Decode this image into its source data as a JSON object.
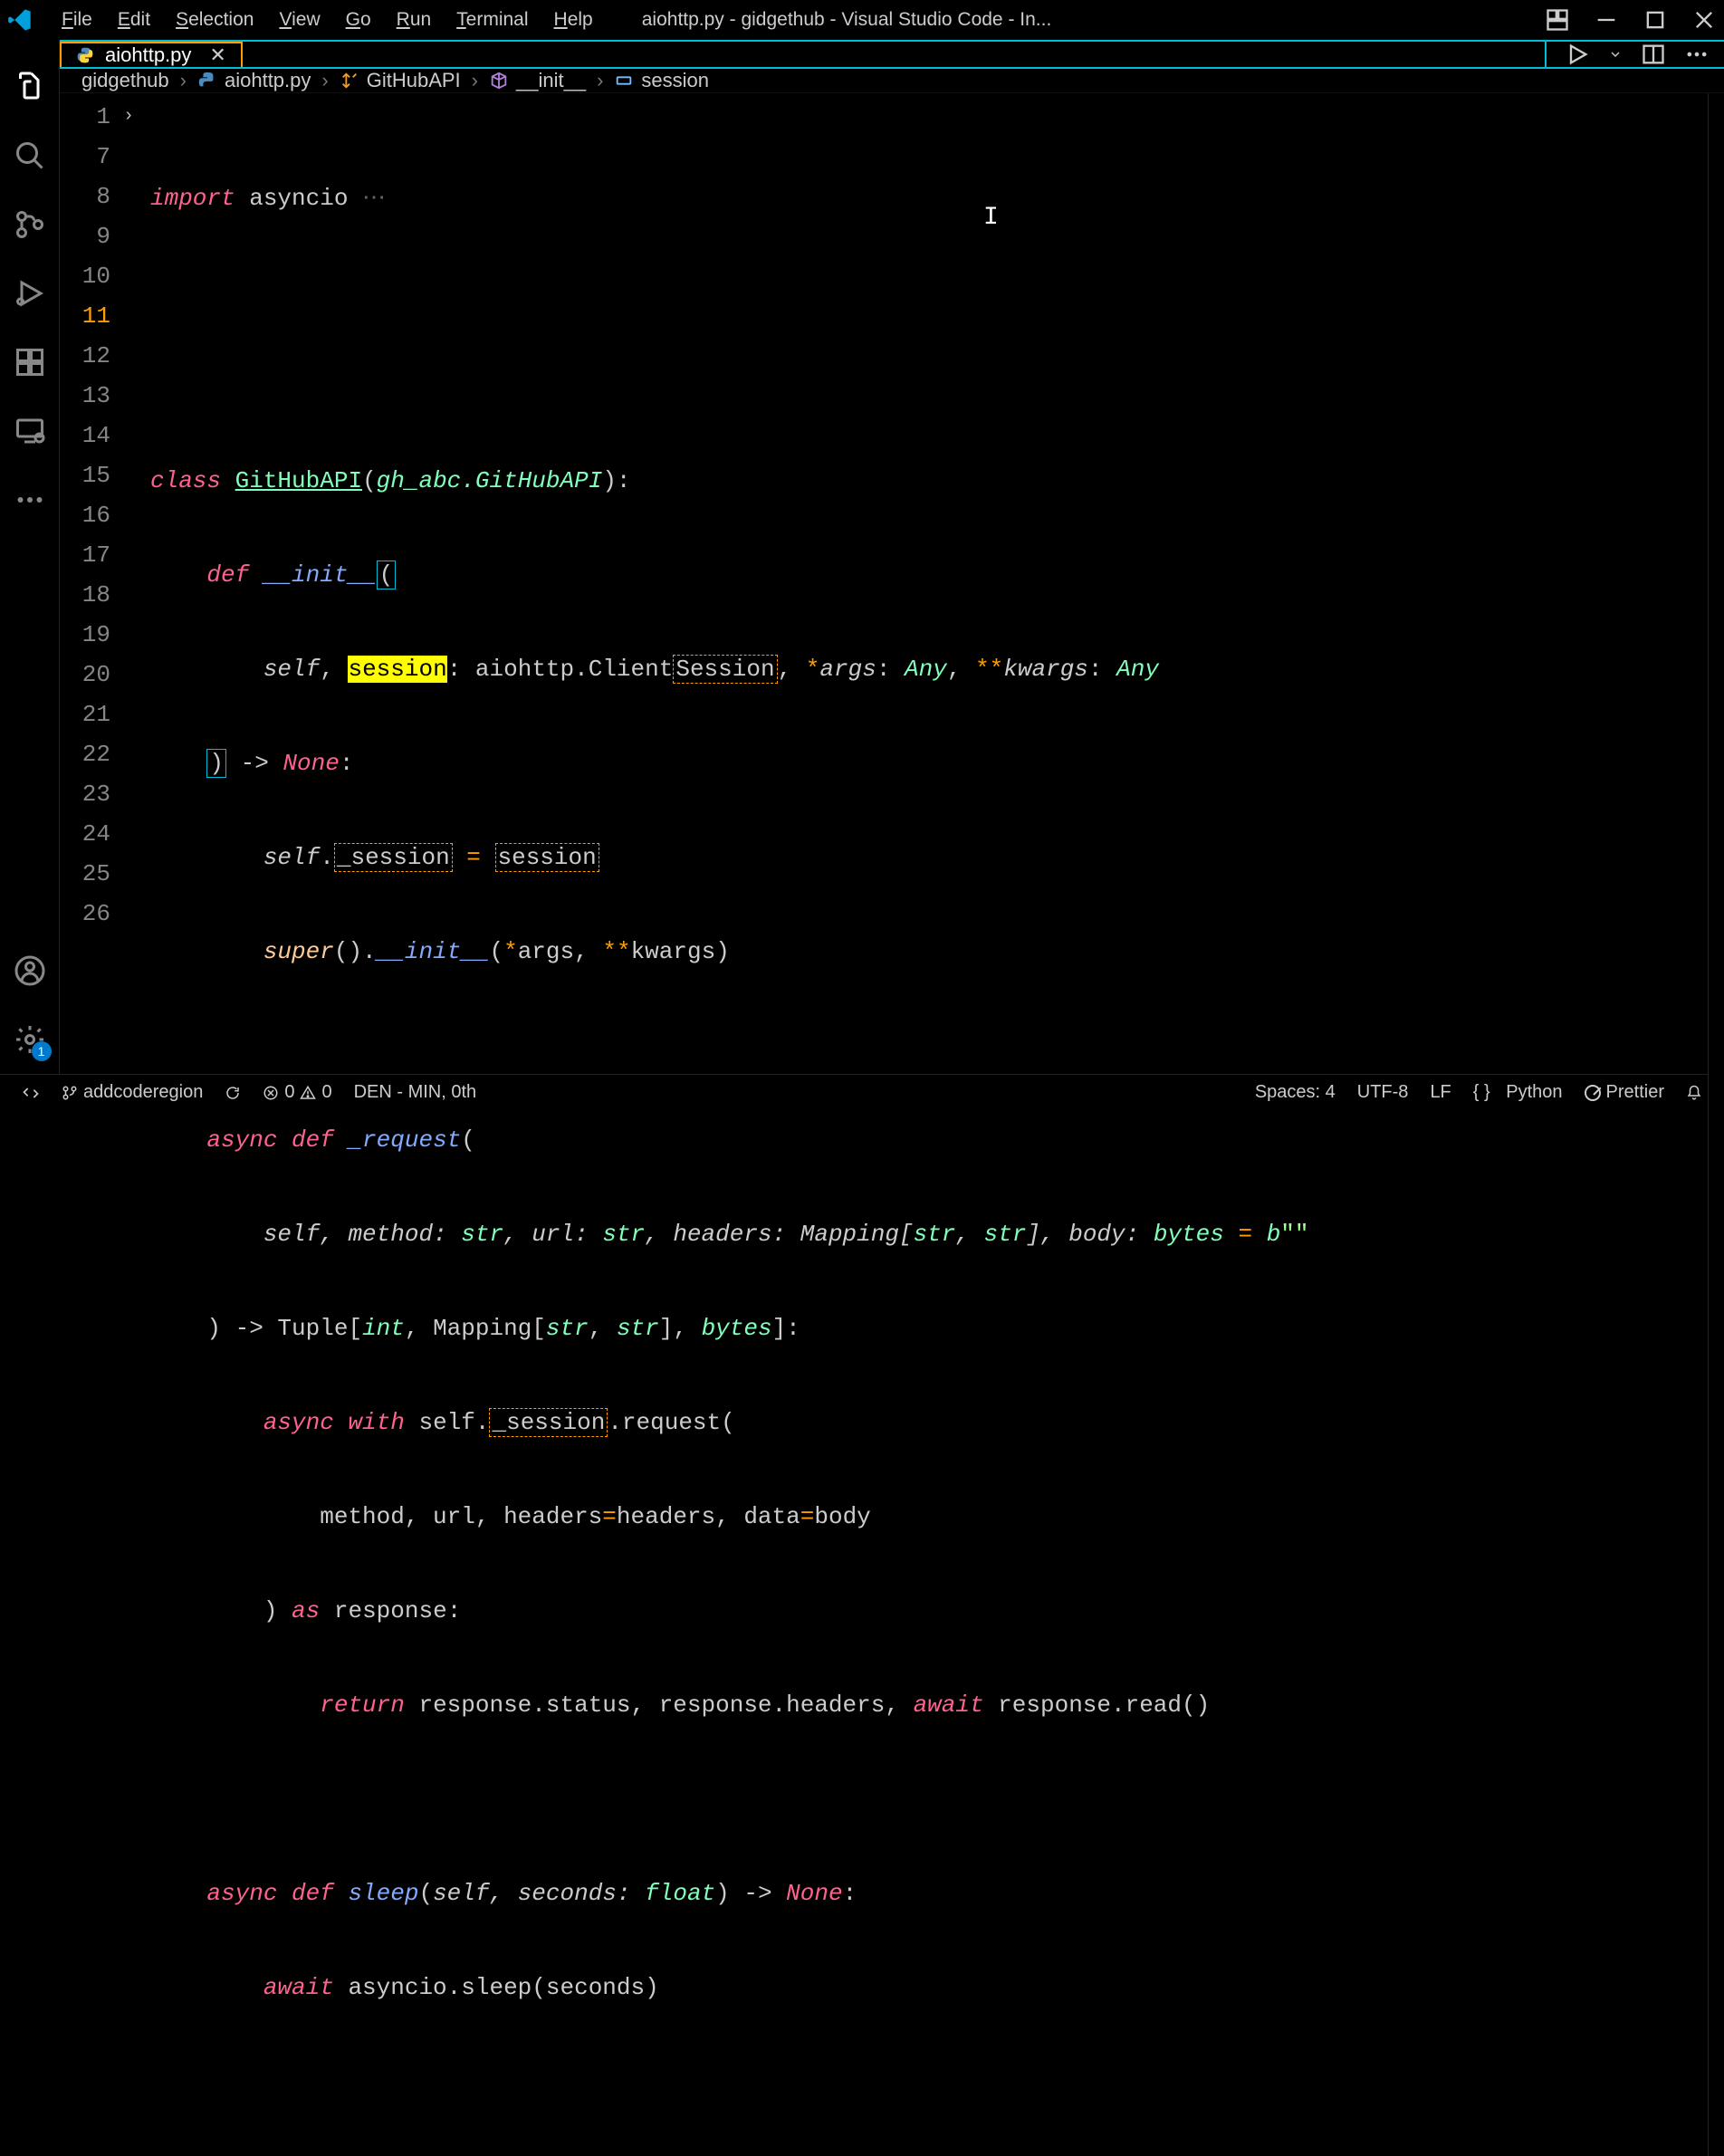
{
  "window_title": "aiohttp.py - gidgethub - Visual Studio Code - In...",
  "menu": [
    "File",
    "Edit",
    "Selection",
    "View",
    "Go",
    "Run",
    "Terminal",
    "Help"
  ],
  "tab": {
    "filename": "aiohttp.py"
  },
  "breadcrumbs": {
    "repo": "gidgethub",
    "file": "aiohttp.py",
    "class": "GitHubAPI",
    "method": "__init__",
    "symbol": "session"
  },
  "line_numbers": [
    "1",
    "7",
    "8",
    "9",
    "10",
    "11",
    "12",
    "13",
    "14",
    "15",
    "16",
    "17",
    "18",
    "19",
    "20",
    "21",
    "22",
    "23",
    "24",
    "25",
    "26"
  ],
  "code": {
    "l1_import": "import",
    "l1_asyncio": " asyncio",
    "l9_class": "class ",
    "l9_name": "GitHubAPI",
    "l9_paren1": "(",
    "l9_base": "gh_abc.GitHubAPI",
    "l9_paren2": "):",
    "l10_def": "def ",
    "l10_name": "__init__",
    "l10_paren": "(",
    "l11_self": "self",
    "l11_comma1": ", ",
    "l11_session": "session",
    "l11_colon1": ": ",
    "l11_aiohttp": "aiohttp.Client",
    "l11_Session": "Session",
    "l11_comma2": ", ",
    "l11_star": "*",
    "l11_args": "args",
    "l11_colon2": ": ",
    "l11_any1": "Any",
    "l11_comma3": ", ",
    "l11_dstar": "**",
    "l11_kwargs": "kwargs",
    "l11_colon3": ": ",
    "l11_any2": "Any",
    "l12_paren": ")",
    "l12_arrow": " -> ",
    "l12_none": "None",
    "l12_colon": ":",
    "l13_self": "self",
    "l13_dot": ".",
    "l13_session": "_session",
    "l13_eq": " = ",
    "l13_val": "session",
    "l14_super": "super",
    "l14_paren1": "().",
    "l14_init": "__init__",
    "l14_paren2": "(",
    "l14_star": "*",
    "l14_args": "args",
    "l14_comma": ", ",
    "l14_dstar": "**",
    "l14_kwargs": "kwargs",
    "l14_paren3": ")",
    "l16_async": "async def ",
    "l16_name": "_request",
    "l16_paren": "(",
    "l17_self": "self",
    "l17_c1": ", method: ",
    "l17_str1": "str",
    "l17_c2": ", url: ",
    "l17_str2": "str",
    "l17_c3": ", headers: Mapping[",
    "l17_str3": "str",
    "l17_c4": ", ",
    "l17_str4": "str",
    "l17_c5": "], body: ",
    "l17_bytes": "bytes",
    "l17_eq": " = ",
    "l17_b": "b",
    "l17_quotes": "\"\"",
    "l18_paren": ") -> Tuple[",
    "l18_int": "int",
    "l18_c1": ", Mapping[",
    "l18_str1": "str",
    "l18_c2": ", ",
    "l18_str2": "str",
    "l18_c3": "], ",
    "l18_bytes": "bytes",
    "l18_c4": "]:",
    "l19_async": "async with",
    "l19_self": " self.",
    "l19_session": "_session",
    "l19_req": ".request(",
    "l20_body": "method, url, headers",
    "l20_eq1": "=",
    "l20_h": "headers",
    "l20_c": ", data",
    "l20_eq2": "=",
    "l20_d": "body",
    "l21_paren": ") ",
    "l21_as": "as",
    "l21_resp": " response:",
    "l22_return": "return",
    "l22_body": " response.status, response.headers, ",
    "l22_await": "await",
    "l22_read": " response.read()",
    "l24_async": "async def ",
    "l24_name": "sleep",
    "l24_p1": "(",
    "l24_self": "self",
    "l24_c": ", seconds: ",
    "l24_float": "float",
    "l24_p2": ") -> ",
    "l24_none": "None",
    "l24_colon": ":",
    "l25_await": "await",
    "l25_body": " asyncio.sleep(seconds)"
  },
  "status": {
    "branch": "addcoderegion",
    "errors": "0",
    "warnings": "0",
    "den": "DEN - MIN, 0th",
    "spaces": "Spaces: 4",
    "encoding": "UTF-8",
    "eol": "LF",
    "lang": "Python",
    "prettier": "Prettier"
  },
  "gear_badge": "1"
}
